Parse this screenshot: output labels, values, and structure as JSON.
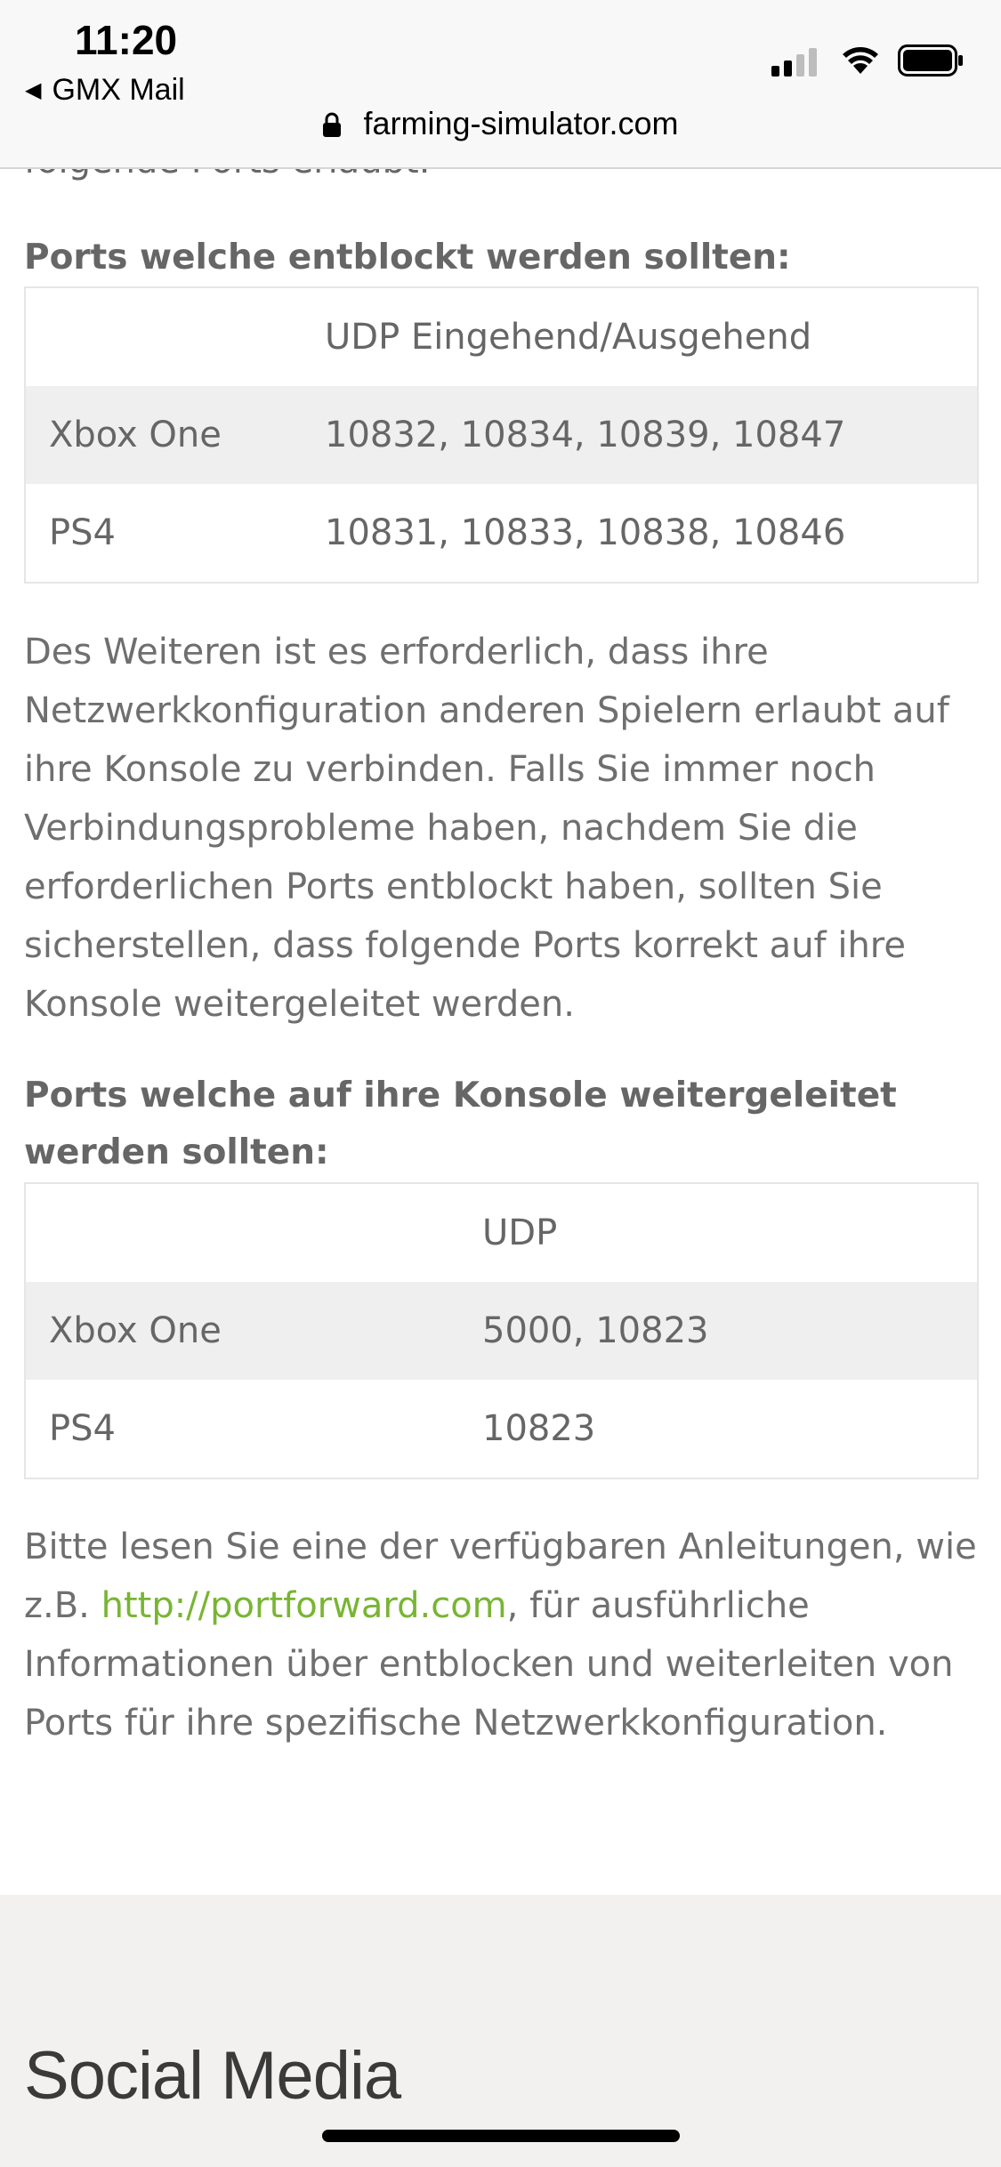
{
  "status_bar": {
    "time": "11:20",
    "back_app": "GMX Mail",
    "url": "farming-simulator.com"
  },
  "article": {
    "cut_line": "folgende Ports erlaubt.",
    "section1": {
      "heading": "Ports welche entblockt werden sollten:",
      "table": {
        "header": [
          "",
          "UDP Eingehend/Ausgehend"
        ],
        "rows": [
          [
            "Xbox One",
            "10832, 10834, 10839, 10847"
          ],
          [
            "PS4",
            "10831, 10833, 10838, 10846"
          ]
        ]
      }
    },
    "paragraph1": "Des Weiteren ist es erforderlich, dass ihre Netzwerkkonfiguration anderen Spielern erlaubt auf ihre Konsole zu verbinden. Falls Sie immer noch Verbindungsprobleme haben, nachdem Sie die erforderlichen Ports entblockt haben, sollten Sie sicherstellen, dass folgende Ports korrekt auf ihre Konsole weitergeleitet werden.",
    "section2": {
      "heading": "Ports welche auf ihre Konsole weitergeleitet werden sollten:",
      "table": {
        "header": [
          "",
          "UDP"
        ],
        "rows": [
          [
            "Xbox One",
            "5000, 10823"
          ],
          [
            "PS4",
            "10823"
          ]
        ]
      }
    },
    "paragraph2": {
      "before_link": "Bitte lesen Sie eine der verfügbaren Anleitungen, wie z.B. ",
      "link": "http://portforward.com",
      "after_link": ", für ausführliche Informationen über entblocken und weiterleiten von Ports für ihre spezifische Netzwerkkonfiguration."
    }
  },
  "footer": {
    "title": "Social Media"
  },
  "colors": {
    "link": "#78b533",
    "text": "#666666",
    "footer_bg": "#f3f1f0"
  }
}
